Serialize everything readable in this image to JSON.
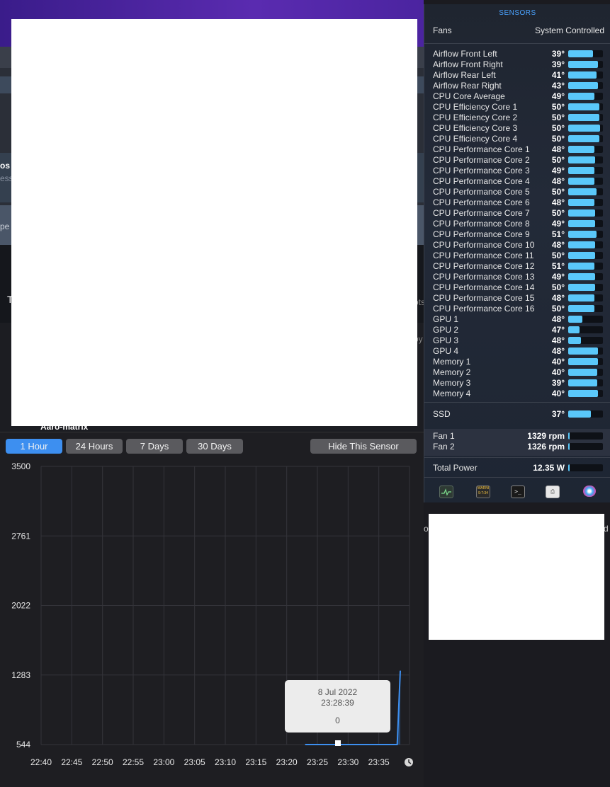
{
  "background": {
    "fragments": [
      "os",
      "ess",
      "pe",
      "T",
      "ots",
      "py",
      "Aaro-matrix",
      "oc",
      "d"
    ]
  },
  "sensors": {
    "title": "SENSORS",
    "fans_label": "Fans",
    "fans_mode": "System Controlled",
    "temperatures": [
      {
        "name": "Airflow Front Left",
        "value": "39°",
        "level": 0.72
      },
      {
        "name": "Airflow Front Right",
        "value": "39°",
        "level": 0.85
      },
      {
        "name": "Airflow Rear Left",
        "value": "41°",
        "level": 0.82
      },
      {
        "name": "Airflow Rear Right",
        "value": "43°",
        "level": 0.85
      },
      {
        "name": "CPU Core Average",
        "value": "49°",
        "level": 0.76
      },
      {
        "name": "CPU Efficiency Core 1",
        "value": "50°",
        "level": 0.9
      },
      {
        "name": "CPU Efficiency Core 2",
        "value": "50°",
        "level": 0.9
      },
      {
        "name": "CPU Efficiency Core 3",
        "value": "50°",
        "level": 0.92
      },
      {
        "name": "CPU Efficiency Core 4",
        "value": "50°",
        "level": 0.9
      },
      {
        "name": "CPU Performance Core 1",
        "value": "48°",
        "level": 0.76
      },
      {
        "name": "CPU Performance Core 2",
        "value": "50°",
        "level": 0.78
      },
      {
        "name": "CPU Performance Core 3",
        "value": "49°",
        "level": 0.76
      },
      {
        "name": "CPU Performance Core 4",
        "value": "48°",
        "level": 0.76
      },
      {
        "name": "CPU Performance Core 5",
        "value": "50°",
        "level": 0.82
      },
      {
        "name": "CPU Performance Core 6",
        "value": "48°",
        "level": 0.76
      },
      {
        "name": "CPU Performance Core 7",
        "value": "50°",
        "level": 0.78
      },
      {
        "name": "CPU Performance Core 8",
        "value": "49°",
        "level": 0.78
      },
      {
        "name": "CPU Performance Core 9",
        "value": "51°",
        "level": 0.82
      },
      {
        "name": "CPU Performance Core 10",
        "value": "48°",
        "level": 0.78
      },
      {
        "name": "CPU Performance Core 11",
        "value": "50°",
        "level": 0.78
      },
      {
        "name": "CPU Performance Core 12",
        "value": "51°",
        "level": 0.76
      },
      {
        "name": "CPU Performance Core 13",
        "value": "49°",
        "level": 0.78
      },
      {
        "name": "CPU Performance Core 14",
        "value": "50°",
        "level": 0.78
      },
      {
        "name": "CPU Performance Core 15",
        "value": "48°",
        "level": 0.76
      },
      {
        "name": "CPU Performance Core 16",
        "value": "50°",
        "level": 0.76
      },
      {
        "name": "GPU 1",
        "value": "48°",
        "level": 0.4
      },
      {
        "name": "GPU 2",
        "value": "47°",
        "level": 0.33
      },
      {
        "name": "GPU 3",
        "value": "48°",
        "level": 0.37
      },
      {
        "name": "GPU 4",
        "value": "48°",
        "level": 0.86
      },
      {
        "name": "Memory 1",
        "value": "40°",
        "level": 0.86
      },
      {
        "name": "Memory 2",
        "value": "40°",
        "level": 0.84
      },
      {
        "name": "Memory 3",
        "value": "39°",
        "level": 0.84
      },
      {
        "name": "Memory 4",
        "value": "40°",
        "level": 0.86
      }
    ],
    "ssd": {
      "name": "SSD",
      "value": "37°",
      "level": 0.65
    },
    "fans": [
      {
        "name": "Fan 1",
        "value": "1329 rpm",
        "level": 0.05
      },
      {
        "name": "Fan 2",
        "value": "1326 rpm",
        "level": 0.05
      }
    ],
    "power": {
      "name": "Total Power",
      "value": "12.35 W",
      "level": 0.04
    },
    "footer_icons": [
      "activity-monitor-icon",
      "console-icon",
      "terminal-icon",
      "printer-icon",
      "color-sync-icon"
    ],
    "console_badge": "WARNI 9:7:34"
  },
  "history": {
    "ranges": [
      {
        "label": "1 Hour",
        "active": true
      },
      {
        "label": "24 Hours",
        "active": false
      },
      {
        "label": "7 Days",
        "active": false
      },
      {
        "label": "30 Days",
        "active": false
      }
    ],
    "hide_label": "Hide This Sensor",
    "tooltip": {
      "date": "8 Jul 2022",
      "time": "23:28:39",
      "value": "0"
    },
    "clock_icon": "clock-icon"
  },
  "chart_data": {
    "type": "line",
    "title": "",
    "xlabel": "",
    "ylabel": "",
    "yticks": [
      544,
      1283,
      2022,
      2761,
      3500
    ],
    "ylim": [
      544,
      3500
    ],
    "xticks": [
      "22:40",
      "22:45",
      "22:50",
      "22:55",
      "23:00",
      "23:05",
      "23:10",
      "23:15",
      "23:20",
      "23:25",
      "23:30",
      "23:35"
    ],
    "series": [
      {
        "x": [
          "23:23",
          "23:38",
          "23:38:30"
        ],
        "values": [
          544,
          544,
          1329
        ]
      }
    ],
    "color": "#3d8ff0",
    "grid": true
  }
}
